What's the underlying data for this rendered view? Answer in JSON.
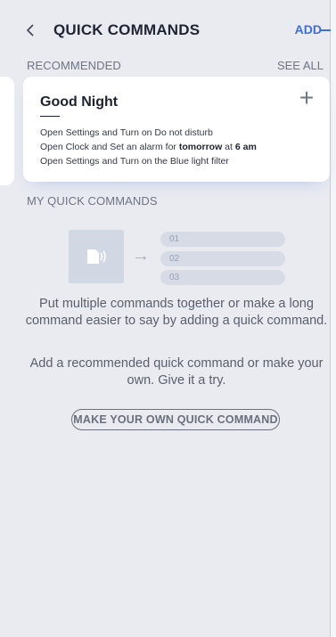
{
  "header": {
    "title": "QUICK COMMANDS",
    "add_label": "ADD"
  },
  "recommended": {
    "section_label": "RECOMMENDED",
    "see_all_label": "SEE ALL",
    "card": {
      "title": "Good Night",
      "commands": [
        {
          "prefix": "Open Settings and Turn on Do not disturb",
          "bold": "",
          "suffix": "",
          "bold2": "",
          "suffix2": ""
        },
        {
          "prefix": "Open Clock and Set an alarm for ",
          "bold": "tomorrow",
          "suffix": " at ",
          "bold2": "6 am",
          "suffix2": ""
        },
        {
          "prefix": "Open Settings and Turn on the Blue light filter",
          "bold": "",
          "suffix": "",
          "bold2": "",
          "suffix2": ""
        }
      ]
    }
  },
  "my_commands": {
    "section_label": "MY QUICK COMMANDS",
    "illustration_items": [
      "01",
      "02",
      "03"
    ],
    "description_1": "Put multiple commands together or make a long command easier to say by adding a quick command.",
    "description_2": "Add a recommended quick command or make your own. Give it a try.",
    "make_button_label": "MAKE YOUR OWN QUICK COMMAND"
  },
  "icons": {
    "back": "chevron-left-icon",
    "add_card": "plus-icon",
    "illustration": "phone-speech-icon",
    "arrow": "arrow-right-icon"
  },
  "colors": {
    "accent": "#3f6fd6",
    "background": "#e9ebf1",
    "card": "#ffffff"
  }
}
